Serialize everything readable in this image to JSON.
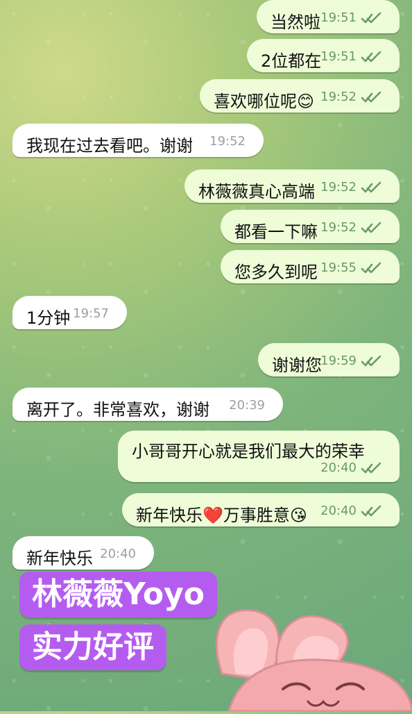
{
  "colors": {
    "outgoing_bubble": "#eefcd8",
    "incoming_bubble": "#ffffff",
    "check": "#6a9a67",
    "promo_purple": "#b55cf0"
  },
  "messages": [
    {
      "dir": "out",
      "text": "当然啦",
      "time": "19:51",
      "status": "read"
    },
    {
      "dir": "out",
      "text": "2位都在",
      "time": "19:51",
      "status": "read"
    },
    {
      "dir": "out",
      "text": "喜欢哪位呢😊",
      "time": "19:52",
      "status": "read"
    },
    {
      "dir": "in",
      "text": "我现在过去看吧。谢谢",
      "time": "19:52"
    },
    {
      "dir": "out",
      "text": "林薇薇真心高端",
      "time": "19:52",
      "status": "read"
    },
    {
      "dir": "out",
      "text": "都看一下嘛",
      "time": "19:52",
      "status": "read"
    },
    {
      "dir": "out",
      "text": "您多久到呢",
      "time": "19:55",
      "status": "read"
    },
    {
      "dir": "in",
      "text": "1分钟",
      "time": "19:57"
    },
    {
      "dir": "out",
      "text": "谢谢您",
      "time": "19:59",
      "status": "read"
    },
    {
      "dir": "in",
      "text": "离开了。非常喜欢，谢谢",
      "time": "20:39"
    },
    {
      "dir": "out",
      "text": "小哥哥开心就是我们最大的荣幸",
      "time": "20:40",
      "status": "read"
    },
    {
      "dir": "out",
      "text": "新年快乐❤️万事胜意😘",
      "time": "20:40",
      "status": "read"
    },
    {
      "dir": "in",
      "text": "新年快乐",
      "time": "20:40"
    }
  ],
  "promo": {
    "line1": "林薇薇Yoyo",
    "line2": "实力好评"
  },
  "sticker": {
    "name": "pink-rabbit-sticker"
  }
}
